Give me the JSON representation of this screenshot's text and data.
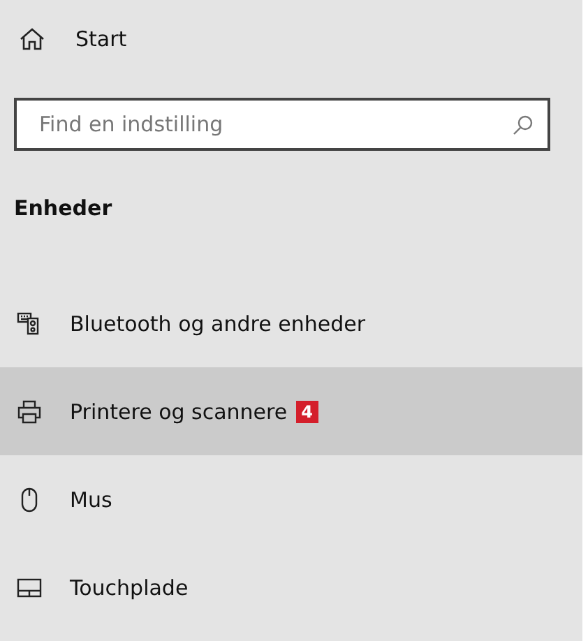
{
  "home": {
    "label": "Start"
  },
  "search": {
    "placeholder": "Find en indstilling"
  },
  "section": {
    "title": "Enheder"
  },
  "items": [
    {
      "label": "Bluetooth og andre enheder",
      "selected": false
    },
    {
      "label": "Printere og scannere",
      "selected": true,
      "badge": "4"
    },
    {
      "label": "Mus",
      "selected": false
    },
    {
      "label": "Touchplade",
      "selected": false
    }
  ]
}
